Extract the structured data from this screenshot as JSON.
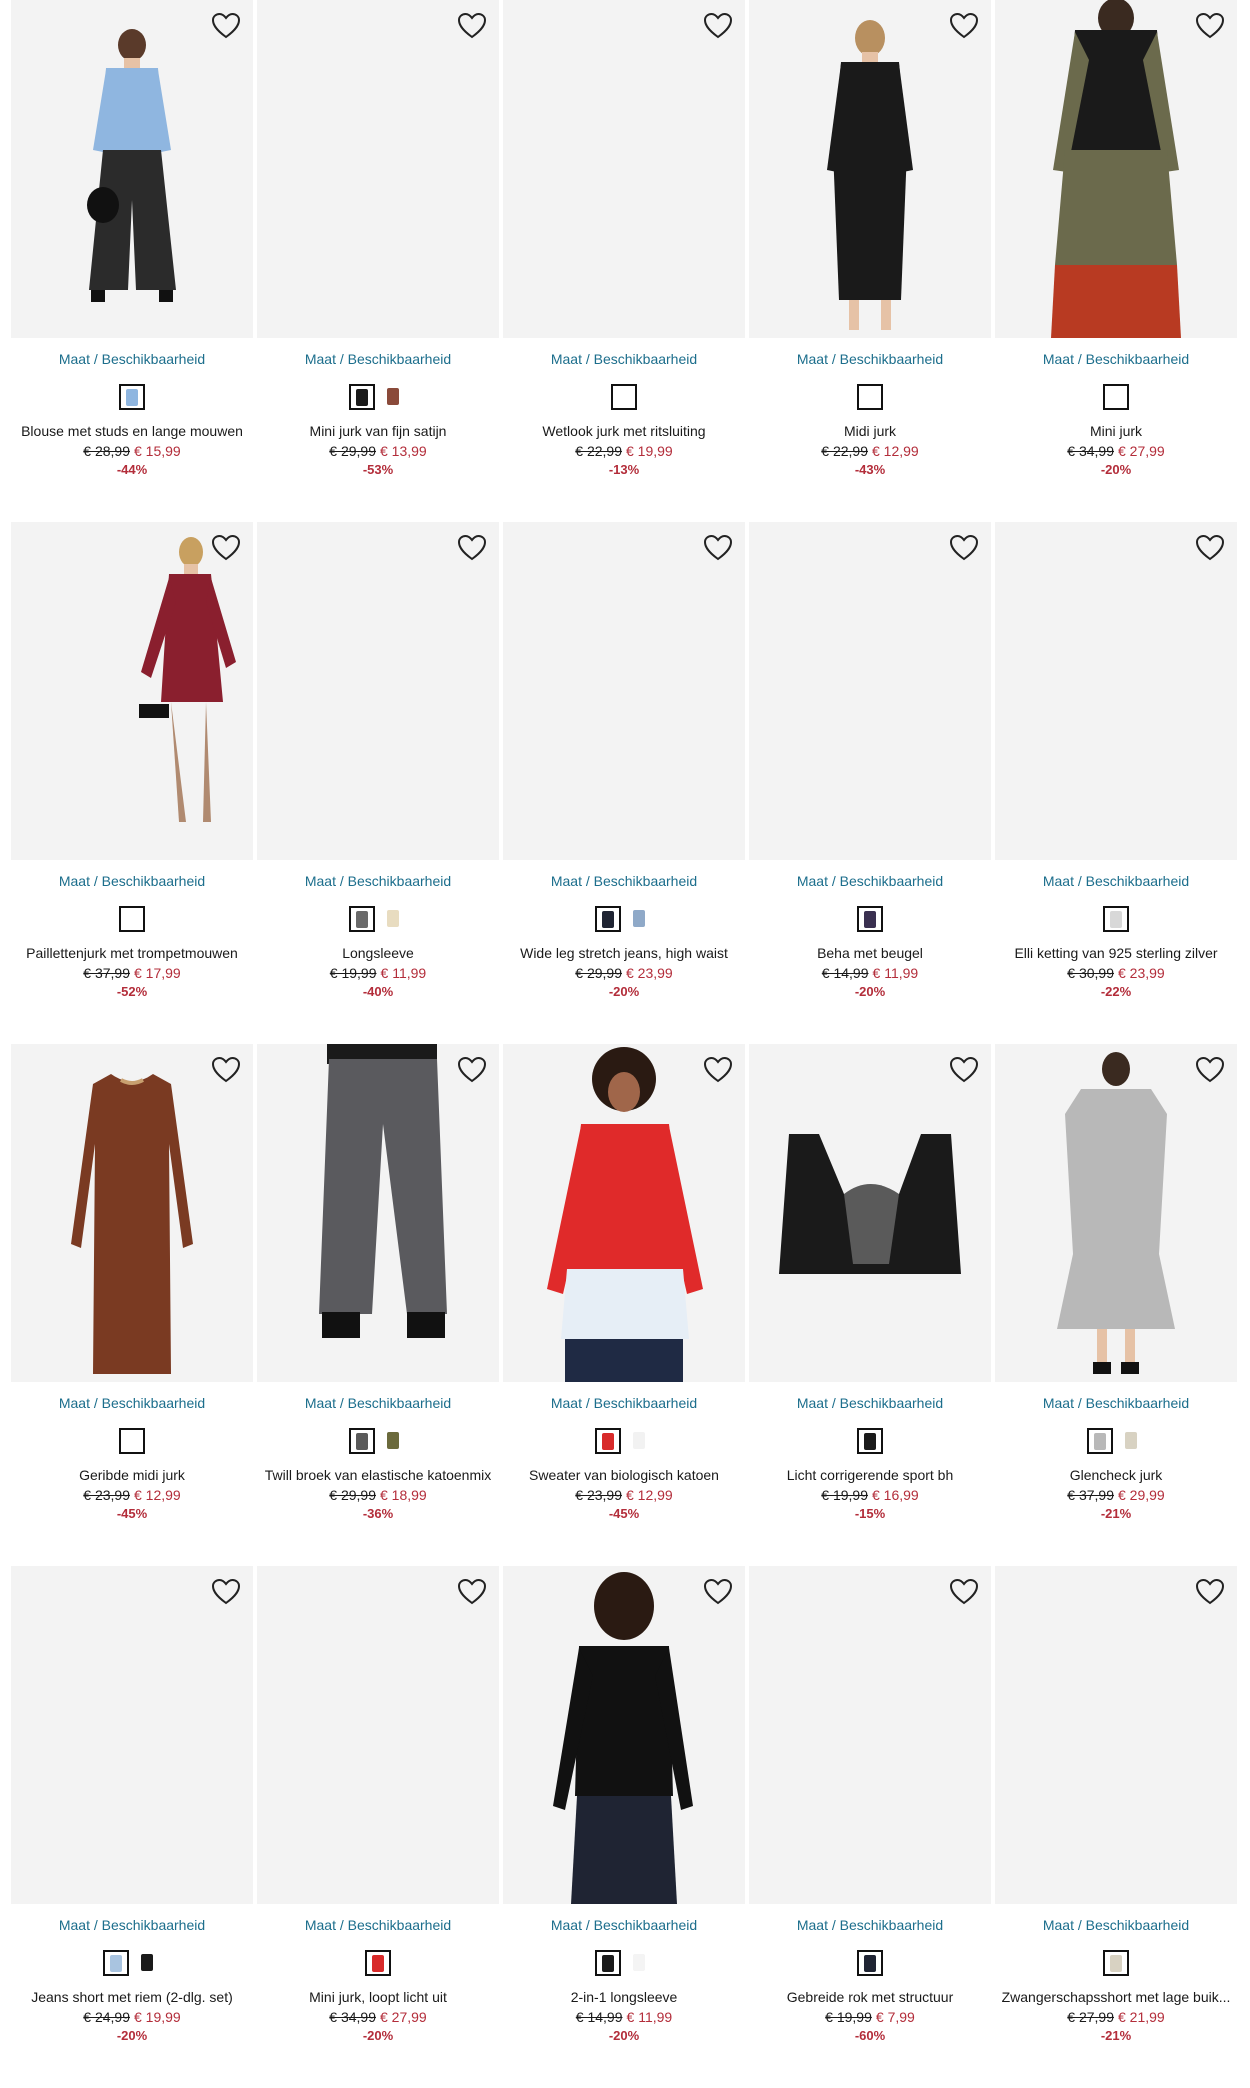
{
  "colors": {
    "link": "#1c6e8c",
    "sale": "#b32d3a",
    "text": "#1a1a1a",
    "image_bg": "#f3f3f3"
  },
  "size_link_label": "Maat / Beschikbaarheid",
  "products": [
    {
      "name": "Blouse met studs en lange mouwen",
      "old_price": "€ 28,99",
      "new_price": "€ 15,99",
      "discount": "-44%",
      "swatches": [
        "#8fb6e0"
      ],
      "image": "blouse"
    },
    {
      "name": "Mini jurk van fijn satijn",
      "old_price": "€ 29,99",
      "new_price": "€ 13,99",
      "discount": "-53%",
      "swatches": [
        "#1a1a1a",
        "#8a4a3a"
      ],
      "image": "empty"
    },
    {
      "name": "Wetlook jurk met ritsluiting",
      "old_price": "€ 22,99",
      "new_price": "€ 19,99",
      "discount": "-13%",
      "swatches": [
        ""
      ],
      "image": "empty"
    },
    {
      "name": "Midi jurk",
      "old_price": "€ 22,99",
      "new_price": "€ 12,99",
      "discount": "-43%",
      "swatches": [
        ""
      ],
      "image": "black-dress"
    },
    {
      "name": "Mini jurk",
      "old_price": "€ 34,99",
      "new_price": "€ 27,99",
      "discount": "-20%",
      "swatches": [
        ""
      ],
      "image": "colorblock-dress"
    },
    {
      "name": "Paillettenjurk met trompetmouwen",
      "old_price": "€ 37,99",
      "new_price": "€ 17,99",
      "discount": "-52%",
      "swatches": [
        ""
      ],
      "image": "sequin-dress"
    },
    {
      "name": "Longsleeve",
      "old_price": "€ 19,99",
      "new_price": "€ 11,99",
      "discount": "-40%",
      "swatches": [
        "#6a6a6a",
        "#e8dcc0"
      ],
      "image": "empty"
    },
    {
      "name": "Wide leg stretch jeans, high waist",
      "old_price": "€ 29,99",
      "new_price": "€ 23,99",
      "discount": "-20%",
      "swatches": [
        "#1f2433",
        "#8fa9c8"
      ],
      "image": "empty"
    },
    {
      "name": "Beha met beugel",
      "old_price": "€ 14,99",
      "new_price": "€ 11,99",
      "discount": "-20%",
      "swatches": [
        "#3a3050"
      ],
      "image": "empty"
    },
    {
      "name": "Elli ketting van 925 sterling zilver",
      "old_price": "€ 30,99",
      "new_price": "€ 23,99",
      "discount": "-22%",
      "swatches": [
        "#d8d8d8"
      ],
      "image": "empty"
    },
    {
      "name": "Geribde midi jurk",
      "old_price": "€ 23,99",
      "new_price": "€ 12,99",
      "discount": "-45%",
      "swatches": [
        ""
      ],
      "image": "brown-dress"
    },
    {
      "name": "Twill broek van elastische katoenmix",
      "old_price": "€ 29,99",
      "new_price": "€ 18,99",
      "discount": "-36%",
      "swatches": [
        "#5a5a5a",
        "#6b6a3c"
      ],
      "image": "grey-pants"
    },
    {
      "name": "Sweater van biologisch katoen",
      "old_price": "€ 23,99",
      "new_price": "€ 12,99",
      "discount": "-45%",
      "swatches": [
        "#d82a2a",
        "#f2f2f2"
      ],
      "image": "red-sweater"
    },
    {
      "name": "Licht corrigerende sport bh",
      "old_price": "€ 19,99",
      "new_price": "€ 16,99",
      "discount": "-15%",
      "swatches": [
        "#1a1a1a"
      ],
      "image": "sport-bra"
    },
    {
      "name": "Glencheck jurk",
      "old_price": "€ 37,99",
      "new_price": "€ 29,99",
      "discount": "-21%",
      "swatches": [
        "#b8b8b8",
        "#d8d2c2"
      ],
      "image": "check-dress"
    },
    {
      "name": "Jeans short met riem (2-dlg. set)",
      "old_price": "€ 24,99",
      "new_price": "€ 19,99",
      "discount": "-20%",
      "swatches": [
        "#a9c4e0",
        "#1a1a1a"
      ],
      "image": "empty"
    },
    {
      "name": "Mini jurk, loopt licht uit",
      "old_price": "€ 34,99",
      "new_price": "€ 27,99",
      "discount": "-20%",
      "swatches": [
        "#d82a2a"
      ],
      "image": "empty"
    },
    {
      "name": "2-in-1 longsleeve",
      "old_price": "€ 14,99",
      "new_price": "€ 11,99",
      "discount": "-20%",
      "swatches": [
        "#1a1a1a",
        "#f4f4f4"
      ],
      "image": "black-longsleeve"
    },
    {
      "name": "Gebreide rok met structuur",
      "old_price": "€ 19,99",
      "new_price": "€ 7,99",
      "discount": "-60%",
      "swatches": [
        "#1f2433"
      ],
      "image": "empty"
    },
    {
      "name": "Zwangerschapsshort met lage buik...",
      "old_price": "€ 27,99",
      "new_price": "€ 21,99",
      "discount": "-21%",
      "swatches": [
        "#d8d2c2"
      ],
      "image": "empty"
    }
  ]
}
